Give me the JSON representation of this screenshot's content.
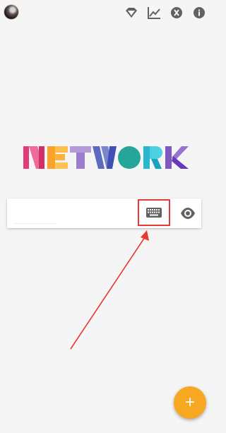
{
  "app": {
    "logo_text": "NETWORK"
  },
  "toolbar": {
    "icons": [
      "diamond-icon",
      "chart-icon",
      "x-circle-icon",
      "info-icon"
    ]
  },
  "search": {
    "value": "",
    "placeholder": ""
  },
  "fab": {
    "label": "+"
  },
  "colors": {
    "background": "#f5f5f5",
    "annotation_red": "#e53935",
    "fab_orange": "#f7a823",
    "icon_gray": "#616161"
  }
}
